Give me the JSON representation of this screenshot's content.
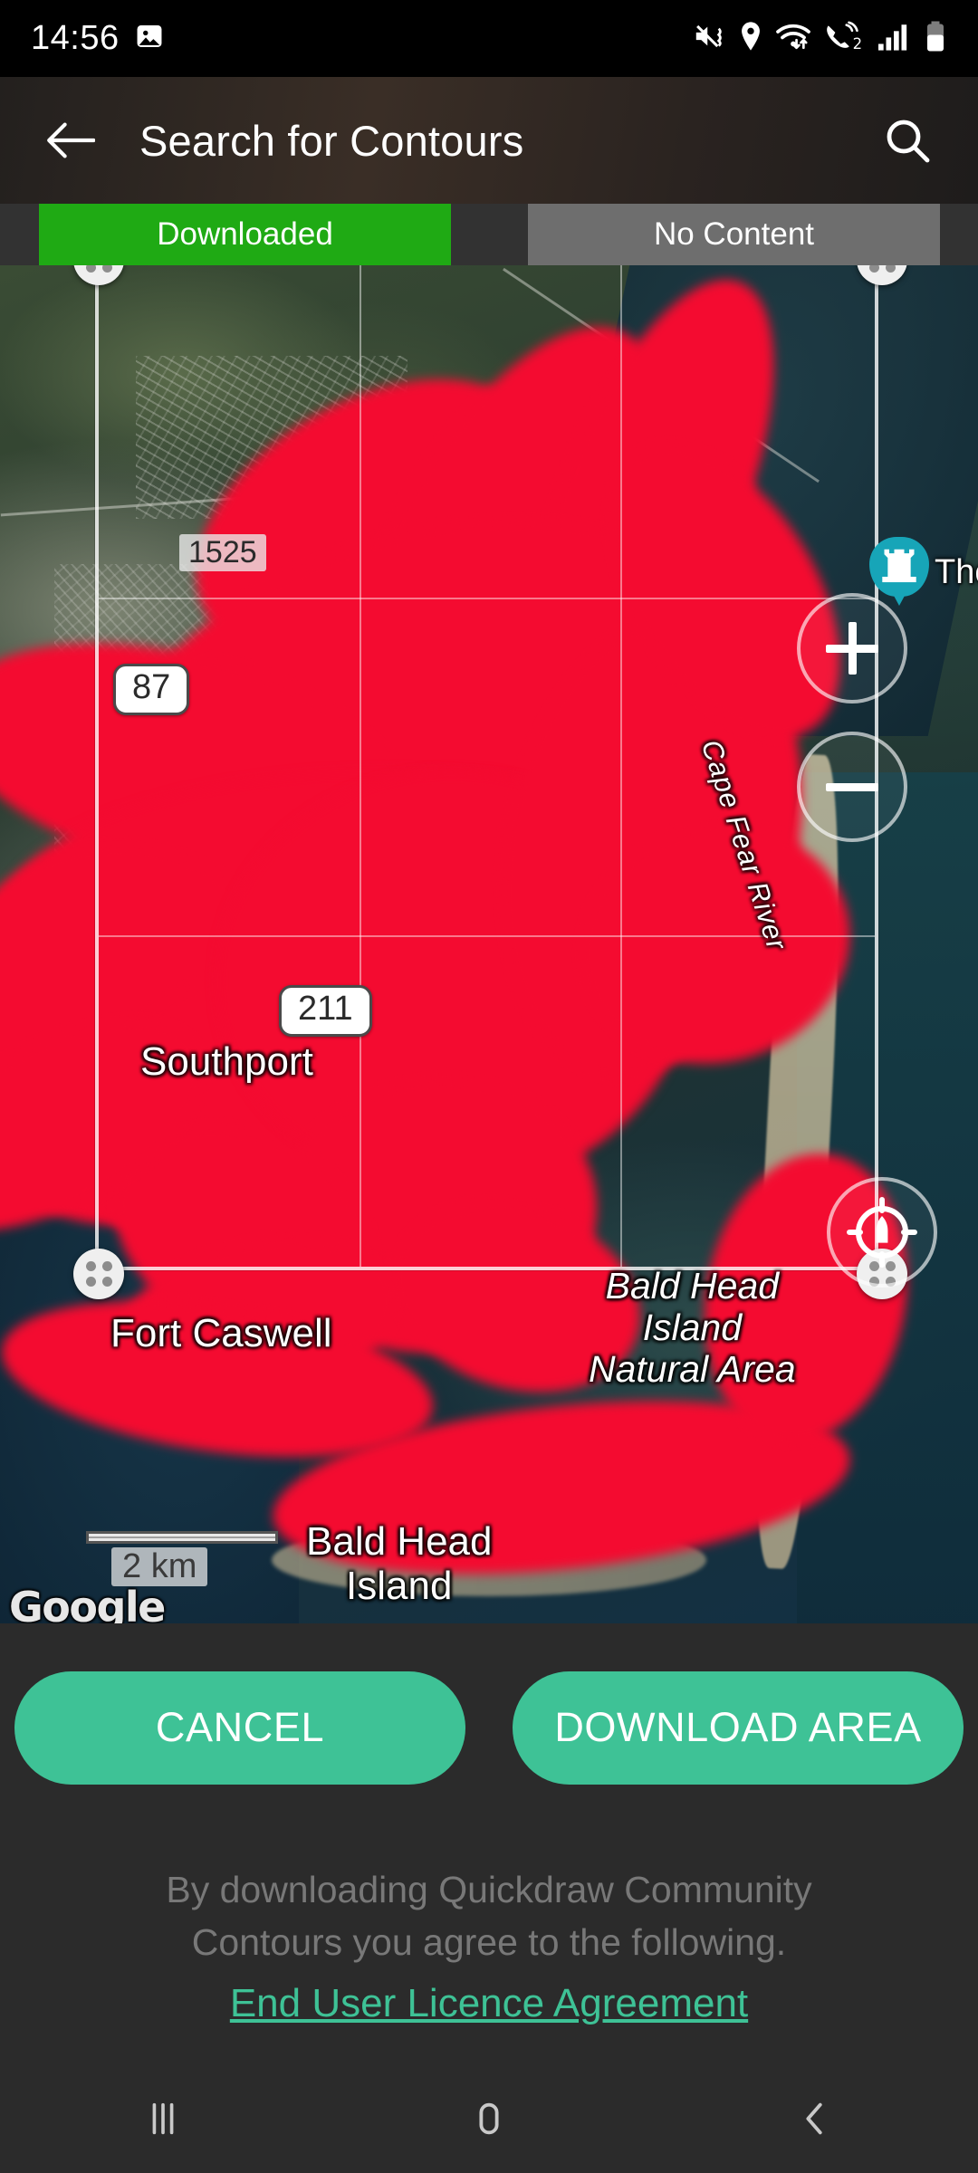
{
  "status_bar": {
    "time": "14:56",
    "left_icons": [
      "image-icon"
    ],
    "right_icons": [
      "mute-vibrate-icon",
      "location-icon",
      "wifi-icon",
      "call-sim2-icon",
      "signal-bars-icon",
      "battery-icon"
    ],
    "sim_badge": "2"
  },
  "app_bar": {
    "back_icon": "back-arrow-icon",
    "title": "Search for Contours",
    "search_icon": "search-icon"
  },
  "legend": {
    "downloaded_label": "Downloaded",
    "downloaded_color": "#1faa14",
    "no_content_label": "No Content",
    "no_content_color": "#6e6e6e"
  },
  "map": {
    "place_labels": {
      "southport": "Southport",
      "fort_caswell": "Fort Caswell",
      "bald_head_island": "Bald Head\nIsland",
      "bald_head_island_natural_area": "Bald Head\nIsland\nNatural Area",
      "cape_fear_river": "Cape Fear River"
    },
    "road_shields": {
      "route_87": "87",
      "route_211": "211",
      "road_1525": "1525"
    },
    "poi": {
      "icon": "fort-castle-icon",
      "label": "The",
      "pin_color": "#17a5b8"
    },
    "scale_bar": "2 km",
    "attribution": "Google",
    "controls": {
      "zoom_in": "+",
      "zoom_out": "−",
      "locate_icon": "locate-vessel-icon"
    },
    "coverage_color": "#f40b30",
    "selection_handles": 4
  },
  "actions": {
    "cancel_label": "CANCEL",
    "download_label": "DOWNLOAD AREA",
    "button_color": "#3ec296"
  },
  "footer": {
    "terms_line1": "By downloading Quickdraw Community",
    "terms_line2": "Contours you agree to the following.",
    "eula_link": "End User Licence Agreement",
    "link_color": "#3ec296"
  },
  "nav_bar": {
    "recents": "recents-icon",
    "home": "home-icon",
    "back": "back-icon"
  }
}
